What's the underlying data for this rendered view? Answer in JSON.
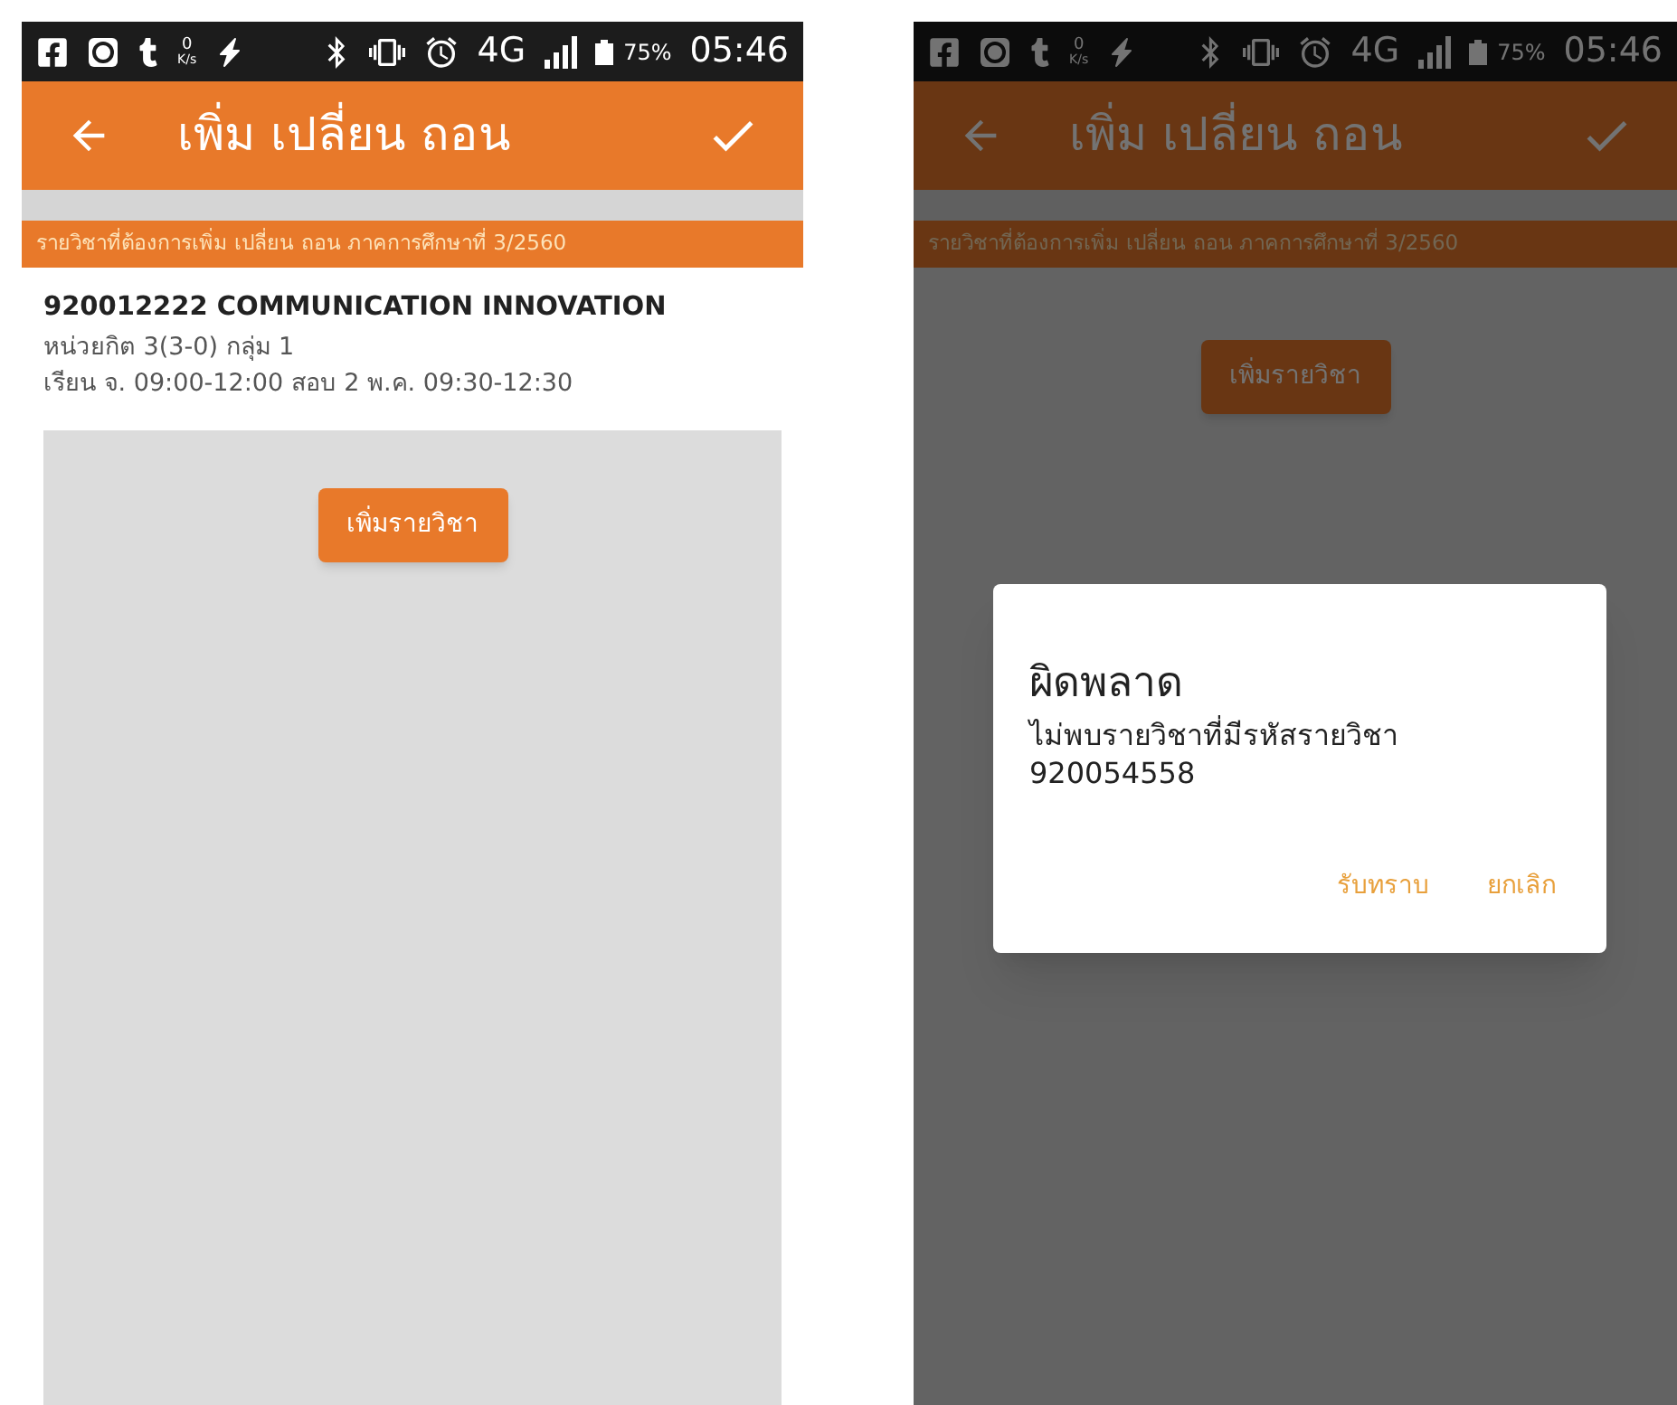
{
  "screens": [
    {
      "dimmed": false,
      "status_bar": {
        "speed_value": "0",
        "speed_unit": "K/s",
        "network": "4G",
        "battery": "75%",
        "time": "05:46"
      },
      "header": {
        "title": "เพิ่ม เปลี่ยน ถอน"
      },
      "subtitle": "รายวิชาที่ต้องการเพิ่ม เปลี่ยน ถอน ภาคการศึกษาที่ 3/2560",
      "course": {
        "title": "920012222 COMMUNICATION INNOVATION",
        "lines": [
          "หน่วยกิต 3(3-0) กลุ่ม 1",
          "เรียน จ. 09:00-12:00 สอบ 2 พ.ค. 09:30-12:30"
        ]
      },
      "add_button": "เพิ่มรายวิชา"
    },
    {
      "dimmed": true,
      "status_bar": {
        "speed_value": "0",
        "speed_unit": "K/s",
        "network": "4G",
        "battery": "75%",
        "time": "05:46"
      },
      "header": {
        "title": "เพิ่ม เปลี่ยน ถอน"
      },
      "subtitle": "รายวิชาที่ต้องการเพิ่ม เปลี่ยน ถอน ภาคการศึกษาที่ 3/2560",
      "add_button": "เพิ่มรายวิชา",
      "dialog": {
        "title": "ผิดพลาด",
        "message": "ไม่พบรายวิชาที่มีรหัสรายวิชา 920054558",
        "buttons": [
          "รับทราบ",
          "ยกเลิก"
        ]
      }
    }
  ]
}
